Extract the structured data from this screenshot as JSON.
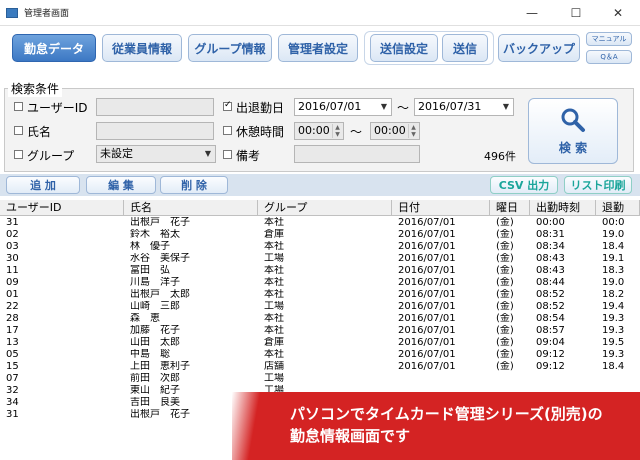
{
  "window": {
    "title": "管理者画面",
    "minimize": "—",
    "maximize": "☐",
    "close": "✕"
  },
  "toolbar": {
    "attendance": "勤怠データ",
    "employees": "従業員情報",
    "groups": "グループ情報",
    "admin": "管理者設定",
    "send_settings": "送信設定",
    "send": "送信",
    "backup": "バックアップ",
    "manual": "マニュアル",
    "qa": "Q＆A"
  },
  "search": {
    "section_title": "検索条件",
    "user_id_label": "ユーザーID",
    "user_id_value": "",
    "name_label": "氏名",
    "name_value": "",
    "group_label": "グループ",
    "group_value": "未設定",
    "clock_date_label": "出退勤日",
    "date_from": "2016/07/01",
    "date_to": "2016/07/31",
    "range_sep": "〜",
    "break_label": "休憩時間",
    "break_from": "00:00",
    "break_to": "00:00",
    "remarks_label": "備考",
    "remarks_value": "",
    "result_count": "496件",
    "search_button": "検 索",
    "clock_date_checked": true
  },
  "actions": {
    "add": "追 加",
    "edit": "編 集",
    "delete": "削 除",
    "csv": "CSV 出力",
    "print": "リスト印刷"
  },
  "table": {
    "columns": [
      "ユーザーID",
      "氏名",
      "グループ",
      "日付",
      "曜日",
      "出勤時刻",
      "退勤"
    ],
    "rows": [
      [
        "31",
        "出根戸　花子",
        "本社",
        "2016/07/01",
        "(金)",
        "00:00",
        "00:0"
      ],
      [
        "02",
        "鈴木　裕太",
        "倉庫",
        "2016/07/01",
        "(金)",
        "08:31",
        "19.0"
      ],
      [
        "03",
        "林　優子",
        "本社",
        "2016/07/01",
        "(金)",
        "08:34",
        "18.4"
      ],
      [
        "30",
        "水谷　美保子",
        "工場",
        "2016/07/01",
        "(金)",
        "08:43",
        "19.1"
      ],
      [
        "11",
        "富田　弘",
        "本社",
        "2016/07/01",
        "(金)",
        "08:43",
        "18.3"
      ],
      [
        "09",
        "川島　洋子",
        "本社",
        "2016/07/01",
        "(金)",
        "08:44",
        "19.0"
      ],
      [
        "01",
        "出根戸　太郎",
        "本社",
        "2016/07/01",
        "(金)",
        "08:52",
        "18.2"
      ],
      [
        "22",
        "山崎　三郎",
        "工場",
        "2016/07/01",
        "(金)",
        "08:52",
        "19.4"
      ],
      [
        "28",
        "森　恵",
        "本社",
        "2016/07/01",
        "(金)",
        "08:54",
        "19.3"
      ],
      [
        "17",
        "加藤　花子",
        "本社",
        "2016/07/01",
        "(金)",
        "08:57",
        "19.3"
      ],
      [
        "13",
        "山田　太郎",
        "倉庫",
        "2016/07/01",
        "(金)",
        "09:04",
        "19.5"
      ],
      [
        "05",
        "中島　聡",
        "本社",
        "2016/07/01",
        "(金)",
        "09:12",
        "19.3"
      ],
      [
        "15",
        "上田　恵利子",
        "店舗",
        "2016/07/01",
        "(金)",
        "09:12",
        "18.4"
      ],
      [
        "07",
        "前田　次郎",
        "工場",
        "",
        "",
        "",
        ""
      ],
      [
        "32",
        "東山　紀子",
        "工場",
        "",
        "",
        "",
        ""
      ],
      [
        "34",
        "吉田　良美",
        "店",
        "",
        "",
        "",
        ""
      ],
      [
        "31",
        "出根戸　花子",
        "",
        "",
        "",
        "",
        ""
      ]
    ]
  },
  "promo": {
    "line1": "パソコンでタイムカード管理シリーズ(別売)の",
    "line2": "勤怠情報画面です"
  }
}
